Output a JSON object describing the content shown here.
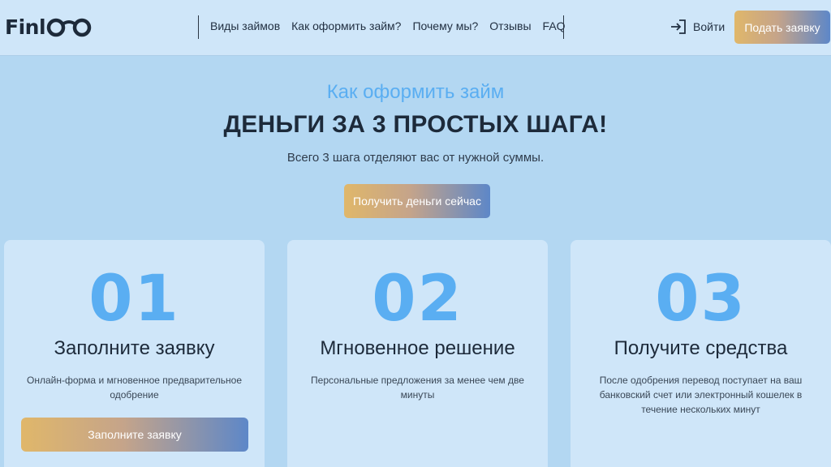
{
  "header": {
    "logo_text": "Finl",
    "nav": [
      "Виды займов",
      "Как оформить займ?",
      "Почему мы?",
      "Отзывы",
      "FAQ"
    ],
    "login_label": "Войти",
    "apply_label": "Подать заявку"
  },
  "hero": {
    "subtitle": "Как оформить займ",
    "title": "ДЕНЬГИ ЗА 3 ПРОСТЫХ ШАГА!",
    "lead": "Всего 3 шага отделяют вас от нужной суммы.",
    "cta_label": "Получить деньги сейчас"
  },
  "steps": [
    {
      "number": "01",
      "title": "Заполните заявку",
      "text": "Онлайн-форма и мгновенное предварительное одобрение",
      "button_label": "Заполните заявку"
    },
    {
      "number": "02",
      "title": "Мгновенное решение",
      "text": "Персональные предложения за менее чем две минуты"
    },
    {
      "number": "03",
      "title": "Получите средства",
      "text": "После одобрения перевод поступает на ваш банковский счет или электронный кошелек в течение нескольких минут"
    }
  ],
  "colors": {
    "accent": "#5aaef2",
    "background": "#b3d7f2",
    "card": "#cfe6f9",
    "gradient_start": "#e0b76a",
    "gradient_end": "#5d87c8"
  }
}
